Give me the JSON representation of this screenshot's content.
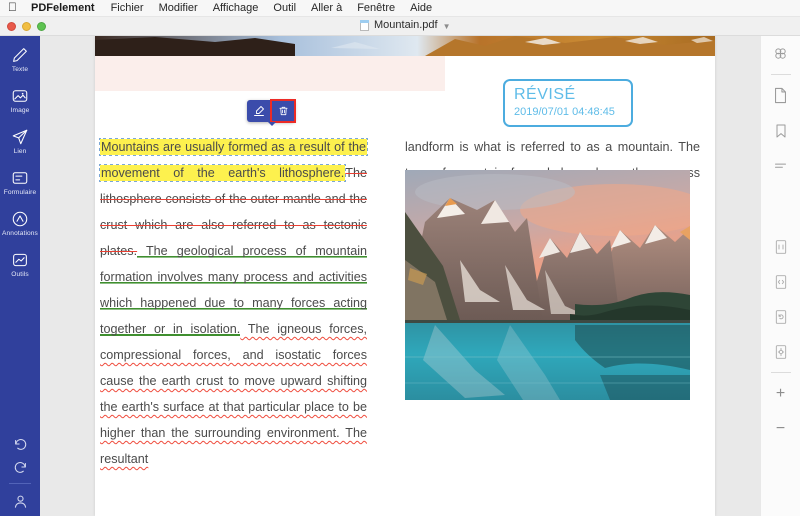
{
  "menubar": {
    "apple_icon": "apple-logo-icon",
    "app_name": "PDFelement",
    "items": [
      "Fichier",
      "Modifier",
      "Affichage",
      "Outil",
      "Aller à",
      "Fenêtre",
      "Aide"
    ]
  },
  "titlebar": {
    "traffic_lights": [
      "close",
      "minimize",
      "zoom"
    ],
    "document_name": "Mountain.pdf",
    "dropdown_chevron": "chevron-down-icon"
  },
  "left_rail": {
    "background_color": "#30409c",
    "items": [
      {
        "label": "Texte",
        "icon": "pencil-icon"
      },
      {
        "label": "Image",
        "icon": "image-icon"
      },
      {
        "label": "Lien",
        "icon": "link-send-icon"
      },
      {
        "label": "Formulaire",
        "icon": "form-icon"
      },
      {
        "label": "Annotations",
        "icon": "annotation-icon"
      },
      {
        "label": "Outils",
        "icon": "tools-icon"
      }
    ],
    "bottom_items": [
      {
        "icon": "undo-icon"
      },
      {
        "icon": "redo-icon"
      },
      {
        "icon": "user-account-icon"
      }
    ]
  },
  "right_rail": {
    "items": [
      {
        "icon": "grid-thumbnails-icon"
      },
      {
        "icon": "page-icon"
      },
      {
        "icon": "bookmark-icon"
      },
      {
        "icon": "list-lines-icon"
      },
      {
        "icon": "page-size-icon"
      },
      {
        "icon": "page-split-icon"
      },
      {
        "icon": "page-rotate-icon"
      },
      {
        "icon": "page-extract-icon"
      },
      {
        "icon": "zoom-in-plus-icon"
      },
      {
        "icon": "zoom-out-minus-icon"
      }
    ]
  },
  "popup_toolbar": {
    "buttons": [
      {
        "icon": "highlighter-pen-icon",
        "selected": false
      },
      {
        "icon": "trash-delete-icon",
        "selected": true
      }
    ],
    "background_color": "#3b4cab",
    "selection_outline_color": "#ec2b26"
  },
  "stamp": {
    "title": "RÉVISÉ",
    "date": "2019/07/01 04:48:45",
    "color": "#5fbce8"
  },
  "document": {
    "left_column": {
      "highlight_text": "Mountains are usually formed as a result of the movement of the earth's lithosphere.",
      "strikethrough_text": "The lithosphere consists of the outer mantle and the crust which are also referred to as tectonic plates.",
      "underline_text": " The geological process of mountain formation involves many process and activities which happened due to many forces acting together or in isolation.",
      "plain_text": " The igneous forces, compressional forces, and isostatic forces cause the earth crust to move upward shifting the earth's surface at that particular place to be higher than the surrounding environment. The resultant"
    },
    "right_column": {
      "paragraph": "landform is what is referred to as a mountain. The type of mountain formed depends on the process that occurred to form it."
    },
    "photo_caption": "mountain-lake-photo",
    "banner_image": "mountain-banner-image",
    "pink_block_color": "#fbeeeb"
  },
  "colors": {
    "highlight_yellow": "#fdf14e",
    "strikethrough_red": "#ea3f32",
    "underline_green": "#3f8f2f",
    "squiggly_red": "#ef4b3c",
    "accent_blue": "#30409c"
  }
}
